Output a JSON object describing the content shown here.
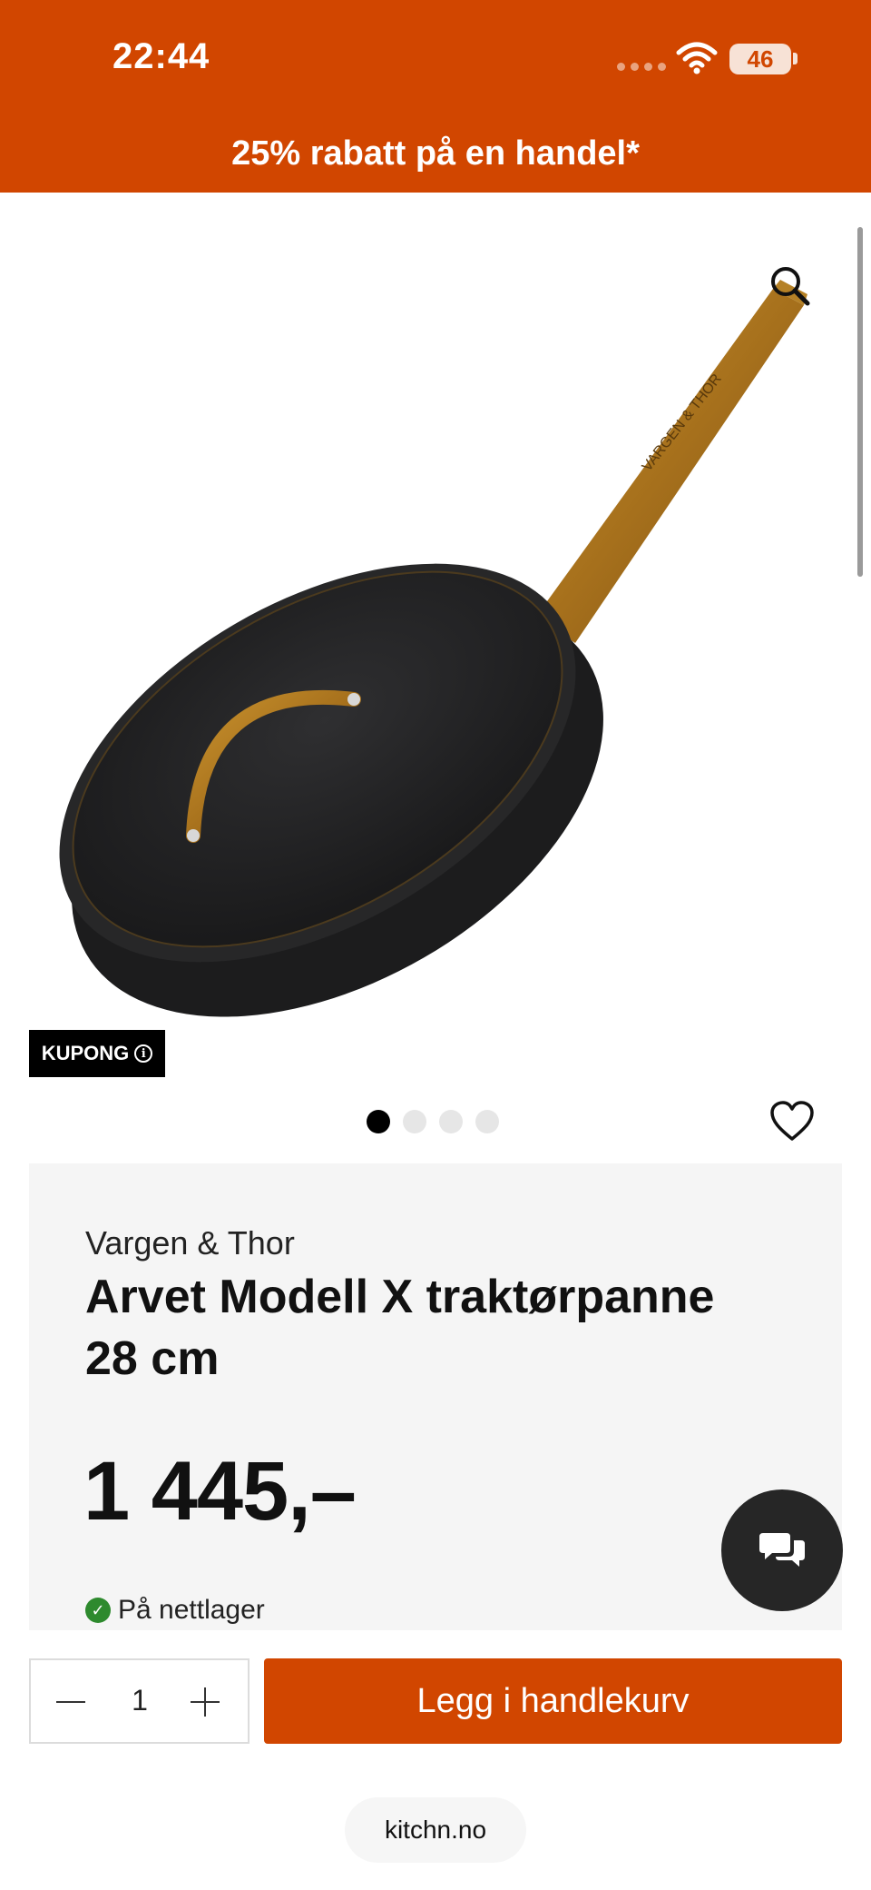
{
  "status_bar": {
    "time": "22:44",
    "battery": "46",
    "icons": [
      "signal-dots-icon",
      "wifi-icon",
      "battery-icon"
    ]
  },
  "promo_banner": {
    "text": "25% rabatt på en handel*"
  },
  "gallery": {
    "badge": "KUPONG",
    "info_glyph": "i",
    "slide_count": 4,
    "active_slide": 1,
    "icons": [
      "zoom-icon",
      "heart-icon"
    ]
  },
  "product": {
    "brand": "Vargen & Thor",
    "title": "Arvet Modell X traktørpanne 28 cm",
    "price": "1 445,–",
    "stock": "På nettlager",
    "handle_engraving": "VARGEN & THOR"
  },
  "purchase": {
    "quantity": "1",
    "add_to_cart": "Legg i handlekurv"
  },
  "browser": {
    "url": "kitchn.no"
  },
  "colors": {
    "brand": "#d14600",
    "card_bg": "#f5f5f5",
    "in_stock": "#2e8a2e",
    "chat_bg": "#262626"
  }
}
